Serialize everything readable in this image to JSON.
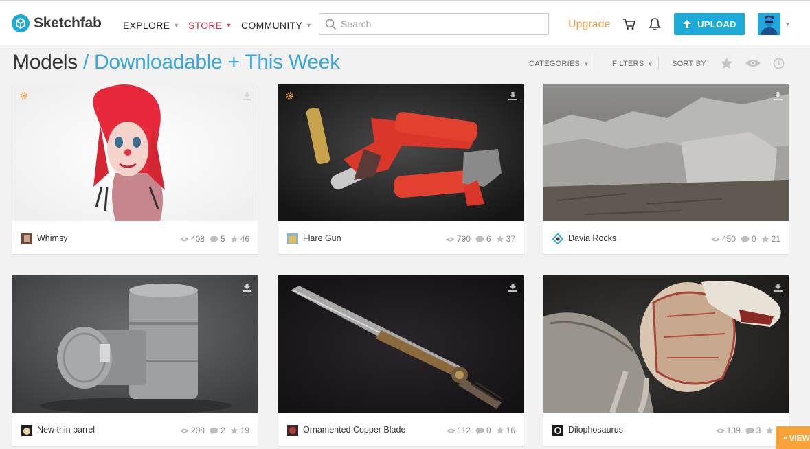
{
  "header": {
    "brand": "Sketchfab",
    "nav": [
      {
        "label": "EXPLORE"
      },
      {
        "label": "STORE"
      },
      {
        "label": "COMMUNITY"
      }
    ],
    "search_placeholder": "Search",
    "upgrade_label": "Upgrade",
    "upload_label": "UPLOAD"
  },
  "title": {
    "main": "Models",
    "sub": " / Downloadable + This Week"
  },
  "toolbar": {
    "categories_label": "CATEGORIES",
    "filters_label": "FILTERS",
    "sort_label": "SORT BY"
  },
  "models": [
    {
      "name": "Whimsy",
      "views": "408",
      "comments": "5",
      "likes": "46"
    },
    {
      "name": "Flare Gun",
      "views": "790",
      "comments": "6",
      "likes": "37"
    },
    {
      "name": "Davia Rocks",
      "views": "450",
      "comments": "0",
      "likes": "21"
    },
    {
      "name": "New thin barrel",
      "views": "208",
      "comments": "2",
      "likes": "19"
    },
    {
      "name": "Ornamented Copper Blade",
      "views": "112",
      "comments": "0",
      "likes": "16"
    },
    {
      "name": "Dilophosaurus",
      "views": "139",
      "comments": "3",
      "likes": "1"
    }
  ],
  "viewer_tab_label": "VIEW",
  "colors": {
    "accent": "#1caad9",
    "store": "#d0324c",
    "upgrade": "#f0a04b",
    "staff_pick": "#f0a04b"
  }
}
